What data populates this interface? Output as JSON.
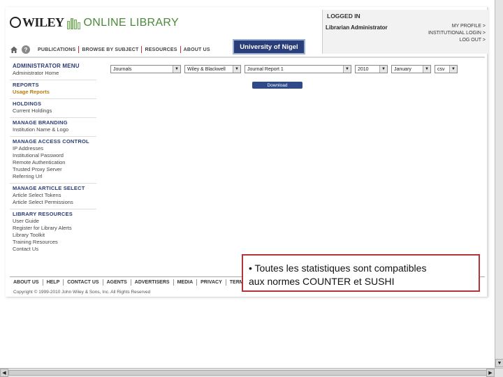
{
  "header": {
    "logo_wiley": "WILEY",
    "logo_online_library": "ONLINE LIBRARY",
    "login": {
      "title": "LOGGED IN",
      "user": "Librarian Administrator",
      "links": [
        "MY PROFILE >",
        "INSTITUTIONAL LOGIN >",
        "LOG OUT >"
      ]
    },
    "nav_tabs": [
      "PUBLICATIONS",
      "BROWSE BY SUBJECT",
      "RESOURCES",
      "ABOUT US"
    ],
    "institution": "University of Nigel"
  },
  "sidebar": {
    "sections": [
      {
        "title": "ADMINISTRATOR MENU",
        "items": [
          "Administrator Home"
        ]
      },
      {
        "title": "REPORTS",
        "items": [
          "Usage Reports"
        ],
        "active": "Usage Reports"
      },
      {
        "title": "HOLDINGS",
        "items": [
          "Current Holdings"
        ]
      },
      {
        "title": "MANAGE BRANDING",
        "items": [
          "Institution Name & Logo"
        ]
      },
      {
        "title": "MANAGE ACCESS CONTROL",
        "items": [
          "IP Addresses",
          "Institutional Password",
          "Remote Authentication",
          "Trusted Proxy Server",
          "Referring Url"
        ]
      },
      {
        "title": "MANAGE ARTICLE SELECT",
        "items": [
          "Article Select Tokens",
          "Article Select Permissions"
        ]
      },
      {
        "title": "LIBRARY RESOURCES",
        "items": [
          "User Guide",
          "Register for Library Alerts",
          "Library Toolkit",
          "Training Resources",
          "Contact Us"
        ]
      }
    ]
  },
  "filters": {
    "content_type": "Journals",
    "publisher": "Wiley & Blackwell",
    "report": "Journal Report 1",
    "year": "2010",
    "month": "January",
    "format": "csv"
  },
  "download_label": "Download",
  "footer": {
    "links": [
      "ABOUT US",
      "HELP",
      "CONTACT US",
      "AGENTS",
      "ADVERTISERS",
      "MEDIA",
      "PRIVACY",
      "TERMS & CONDITIONS"
    ],
    "copyright": "Copyright © 1999-2010 John Wiley & Sons, Inc. All Rights Reserved"
  },
  "callout": {
    "line1": "• Toutes les statistiques sont compatibles",
    "line2": "aux normes COUNTER et SUSHI"
  },
  "colors": {
    "accent_green": "#4b8a3a",
    "nav_blue": "#2b3d77",
    "badge_bg": "#2a3f7a",
    "active_link": "#b57c14",
    "callout_border": "#b7333a"
  }
}
